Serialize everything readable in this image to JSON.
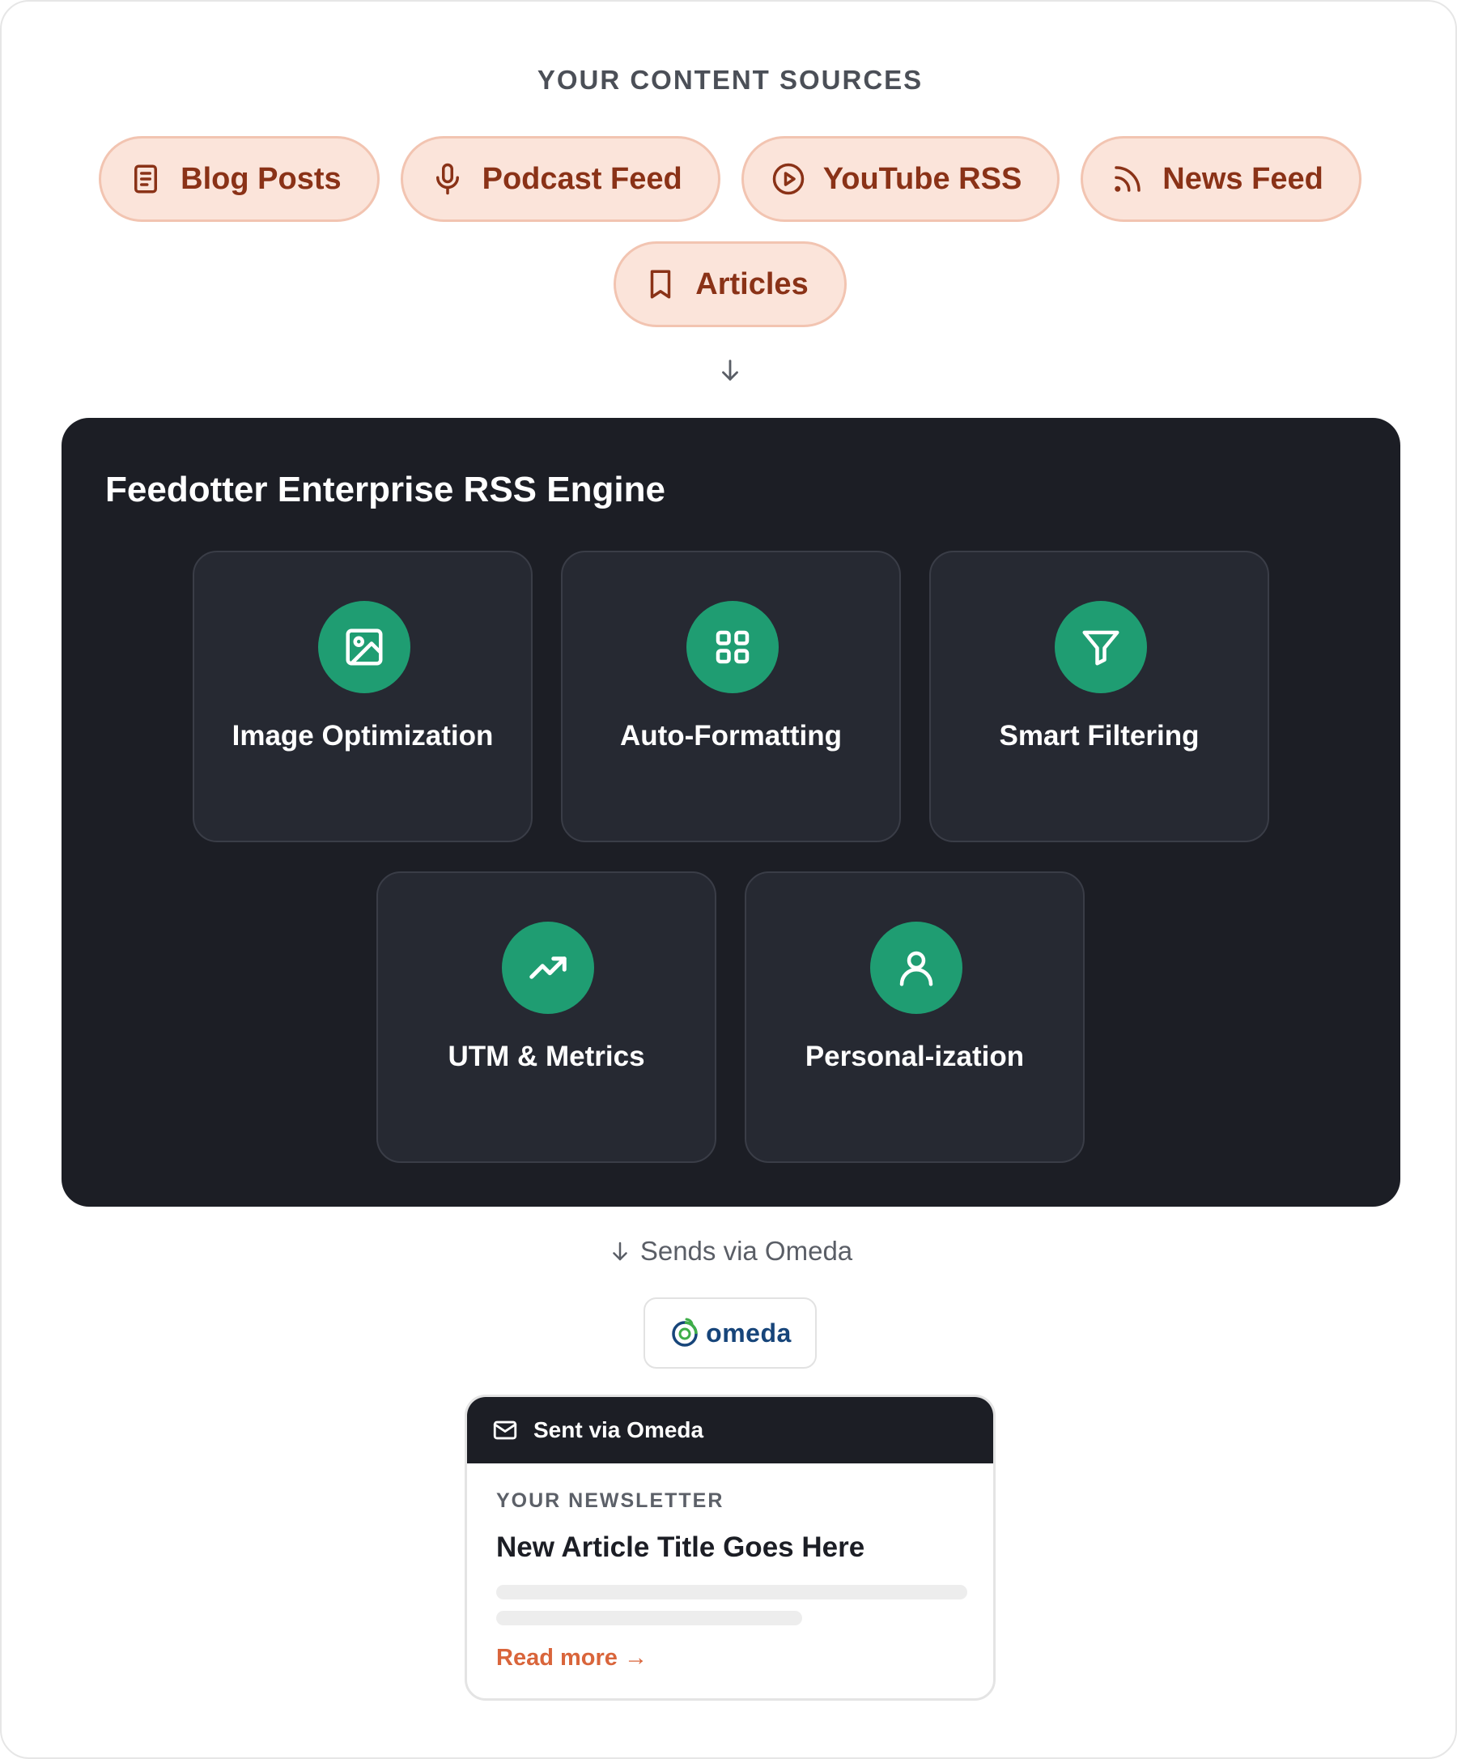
{
  "sources": {
    "title": "YOUR CONTENT SOURCES",
    "items": [
      {
        "label": "Blog Posts",
        "icon": "document-icon"
      },
      {
        "label": "Podcast Feed",
        "icon": "microphone-icon"
      },
      {
        "label": "YouTube RSS",
        "icon": "play-circle-icon"
      },
      {
        "label": "News Feed",
        "icon": "rss-icon"
      },
      {
        "label": "Articles",
        "icon": "bookmark-icon"
      }
    ]
  },
  "engine": {
    "title": "Feedotter Enterprise RSS Engine",
    "features": [
      {
        "label": "Image Optimization",
        "icon": "image-icon"
      },
      {
        "label": "Auto-Formatting",
        "icon": "grid-icon"
      },
      {
        "label": "Smart Filtering",
        "icon": "filter-icon"
      },
      {
        "label": "UTM & Metrics",
        "icon": "trending-up-icon"
      },
      {
        "label": "Personal-ization",
        "icon": "user-icon"
      }
    ]
  },
  "delivery": {
    "sends_text": "Sends via Omeda",
    "logo_text": "omeda"
  },
  "newsletter": {
    "header": "Sent via Omeda",
    "eyebrow": "YOUR NEWSLETTER",
    "title": "New Article Title Goes Here",
    "read_more": "Read more →"
  },
  "colors": {
    "chip_bg": "#fbe4da",
    "chip_text": "#8a3217",
    "engine_bg": "#1c1e25",
    "feature_icon_bg": "#1f9d72",
    "link": "#d9653b"
  }
}
